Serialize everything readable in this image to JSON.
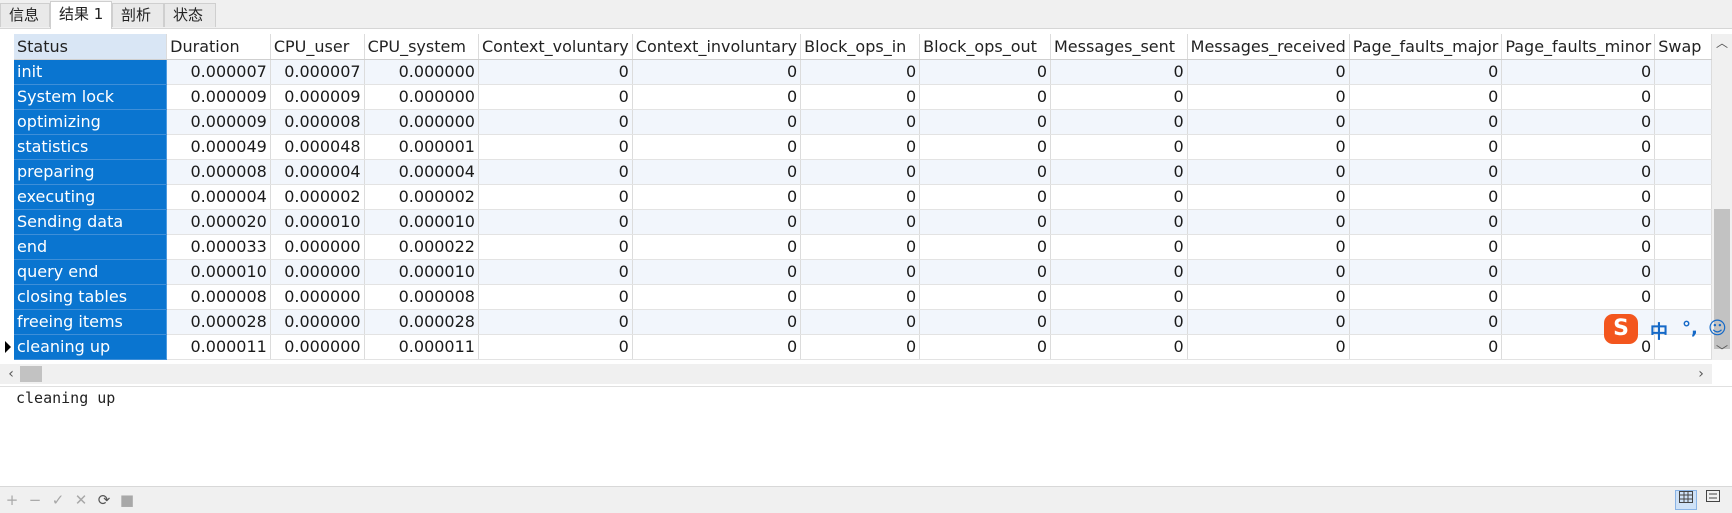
{
  "tabs": [
    {
      "label": "信息"
    },
    {
      "label": "结果 1"
    },
    {
      "label": "剖析"
    },
    {
      "label": "状态"
    }
  ],
  "grid": {
    "columns": [
      "Status",
      "Duration",
      "CPU_user",
      "CPU_system",
      "Context_voluntary",
      "Context_involuntary",
      "Block_ops_in",
      "Block_ops_out",
      "Messages_sent",
      "Messages_received",
      "Page_faults_major",
      "Page_faults_minor",
      "Swap"
    ],
    "rows": [
      [
        "init",
        "0.000007",
        "0.000007",
        "0.000000",
        "0",
        "0",
        "0",
        "0",
        "0",
        "0",
        "0",
        "0",
        ""
      ],
      [
        "System lock",
        "0.000009",
        "0.000009",
        "0.000000",
        "0",
        "0",
        "0",
        "0",
        "0",
        "0",
        "0",
        "0",
        ""
      ],
      [
        "optimizing",
        "0.000009",
        "0.000008",
        "0.000000",
        "0",
        "0",
        "0",
        "0",
        "0",
        "0",
        "0",
        "0",
        ""
      ],
      [
        "statistics",
        "0.000049",
        "0.000048",
        "0.000001",
        "0",
        "0",
        "0",
        "0",
        "0",
        "0",
        "0",
        "0",
        ""
      ],
      [
        "preparing",
        "0.000008",
        "0.000004",
        "0.000004",
        "0",
        "0",
        "0",
        "0",
        "0",
        "0",
        "0",
        "0",
        ""
      ],
      [
        "executing",
        "0.000004",
        "0.000002",
        "0.000002",
        "0",
        "0",
        "0",
        "0",
        "0",
        "0",
        "0",
        "0",
        ""
      ],
      [
        "Sending data",
        "0.000020",
        "0.000010",
        "0.000010",
        "0",
        "0",
        "0",
        "0",
        "0",
        "0",
        "0",
        "0",
        ""
      ],
      [
        "end",
        "0.000033",
        "0.000000",
        "0.000022",
        "0",
        "0",
        "0",
        "0",
        "0",
        "0",
        "0",
        "0",
        ""
      ],
      [
        "query end",
        "0.000010",
        "0.000000",
        "0.000010",
        "0",
        "0",
        "0",
        "0",
        "0",
        "0",
        "0",
        "0",
        ""
      ],
      [
        "closing tables",
        "0.000008",
        "0.000000",
        "0.000008",
        "0",
        "0",
        "0",
        "0",
        "0",
        "0",
        "0",
        "0",
        ""
      ],
      [
        "freeing items",
        "0.000028",
        "0.000000",
        "0.000028",
        "0",
        "0",
        "0",
        "0",
        "0",
        "0",
        "0",
        "",
        ""
      ],
      [
        "cleaning up",
        "0.000011",
        "0.000000",
        "0.000011",
        "0",
        "0",
        "0",
        "0",
        "0",
        "0",
        "0",
        "0",
        ""
      ]
    ]
  },
  "detail": {
    "text": "cleaning up"
  },
  "ime": {
    "logo": "S",
    "mode": "中",
    "punct": "°,",
    "emoji": "☺"
  },
  "icons": {
    "add": "+",
    "remove": "−",
    "apply": "✓",
    "cancel": "✕",
    "refresh": "⟳",
    "stop": "■",
    "scroll_left": "‹",
    "scroll_right": "›",
    "scroll_up": "︿",
    "scroll_down": "﹀"
  },
  "colors": {
    "selection": "#0a75d0",
    "alt_row": "#f2f6fc",
    "ime_logo": "#f3561e"
  }
}
